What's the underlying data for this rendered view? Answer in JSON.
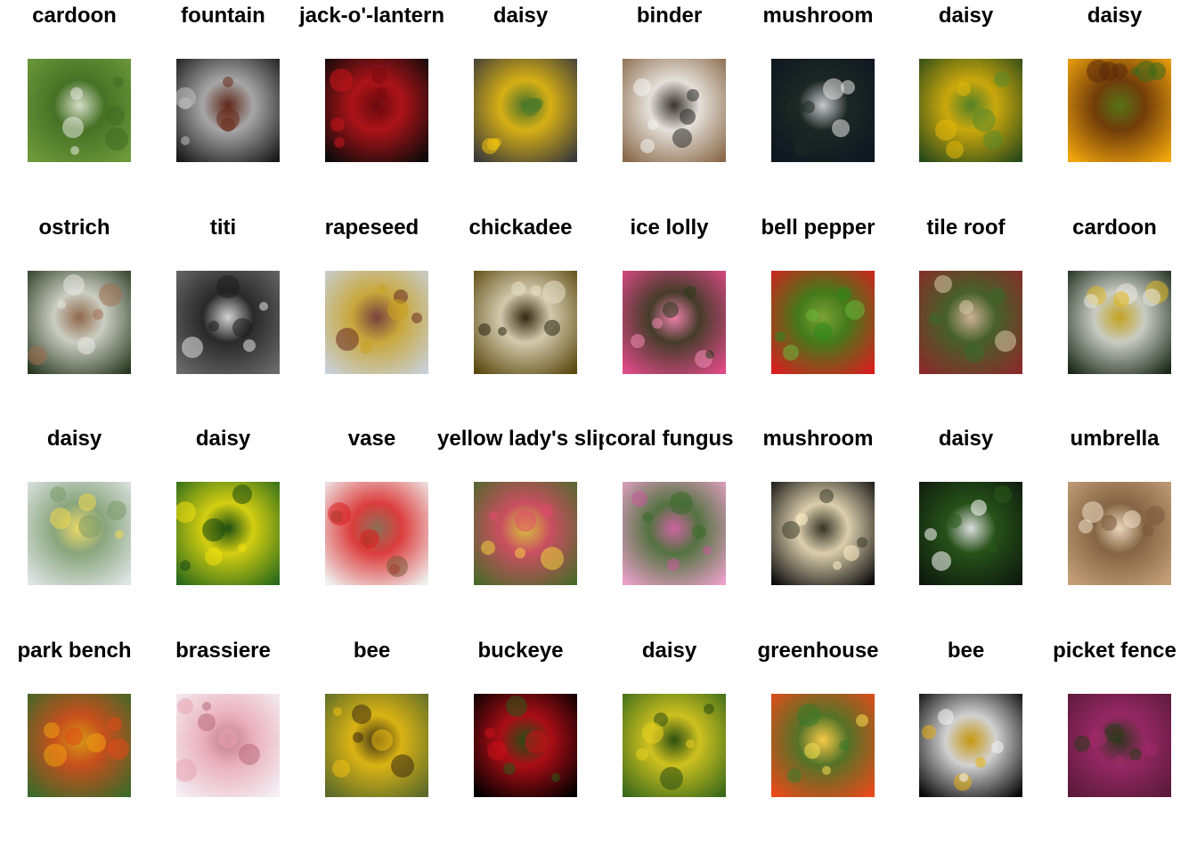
{
  "grid": {
    "columns": 8,
    "items": [
      {
        "label": "cardoon",
        "icon": "dandelion-seedhead-green-photo",
        "colors": [
          "#6f9a3c",
          "#3f6b22",
          "#e8e8e0"
        ]
      },
      {
        "label": "fountain",
        "icon": "dandelion-macro-bw-photo",
        "colors": [
          "#1a1a1a",
          "#bfbfbf",
          "#6a2a1a"
        ]
      },
      {
        "label": "jack-o'-lantern",
        "icon": "red-rose-photo",
        "colors": [
          "#0a0a0a",
          "#c8151b",
          "#7a0a0e"
        ]
      },
      {
        "label": "daisy",
        "icon": "sunflower-photo",
        "colors": [
          "#3a3a3a",
          "#f2c40f",
          "#4a7a2a"
        ]
      },
      {
        "label": "binder",
        "icon": "sticker-sheet-photo",
        "colors": [
          "#8a6a4a",
          "#f4f4f2",
          "#2a2a2a"
        ]
      },
      {
        "label": "mushroom",
        "icon": "dandelion-night-photo",
        "colors": [
          "#0e1620",
          "#1e2a24",
          "#e8e8e8"
        ]
      },
      {
        "label": "daisy",
        "icon": "sunflower-field-photo",
        "colors": [
          "#2a4a1a",
          "#e6b80a",
          "#5a8a2a"
        ]
      },
      {
        "label": "daisy",
        "icon": "sunflower-closeup-photo",
        "colors": [
          "#f3a70c",
          "#5a2a0a",
          "#3a6a1a"
        ]
      },
      {
        "label": "ostrich",
        "icon": "dandelion-blowing-photo",
        "colors": [
          "#2a3a22",
          "#e8e8e0",
          "#a07050"
        ]
      },
      {
        "label": "titi",
        "icon": "dandelion-gray-photo",
        "colors": [
          "#6a6a6a",
          "#1e1e1e",
          "#e4e4e4"
        ]
      },
      {
        "label": "rapeseed",
        "icon": "sunflower-farm-photo",
        "colors": [
          "#c8d0d8",
          "#c8a020",
          "#6a2a20"
        ]
      },
      {
        "label": "chickadee",
        "icon": "dandelion-olive-photo",
        "colors": [
          "#5a4a10",
          "#e8e0c8",
          "#2a2210"
        ]
      },
      {
        "label": "ice lolly",
        "icon": "pink-rose-photo",
        "colors": [
          "#e04a88",
          "#2a3a1a",
          "#f28ab4"
        ]
      },
      {
        "label": "bell pepper",
        "icon": "red-tulips-photo",
        "colors": [
          "#d81e1e",
          "#2a8a1a",
          "#6ab83a"
        ]
      },
      {
        "label": "tile roof",
        "icon": "red-house-garden-photo",
        "colors": [
          "#8a2a2a",
          "#3a6a2a",
          "#d8c8a8"
        ]
      },
      {
        "label": "cardoon",
        "icon": "dandelion-flower-photo",
        "colors": [
          "#1a2a1a",
          "#e8e8e0",
          "#e0b820"
        ]
      },
      {
        "label": "daisy",
        "icon": "white-daisies-photo",
        "colors": [
          "#dfe4e6",
          "#7a9a6a",
          "#f0d850"
        ]
      },
      {
        "label": "daisy",
        "icon": "yellow-dandelions-photo",
        "colors": [
          "#2a6a1a",
          "#f2e010",
          "#1a4a10"
        ]
      },
      {
        "label": "vase",
        "icon": "tulips-vase-photo",
        "colors": [
          "#f0f0f0",
          "#d81e1e",
          "#7a5a3a"
        ]
      },
      {
        "label": "yellow lady's slipper",
        "icon": "tulip-garden-photo",
        "colors": [
          "#4a6a2a",
          "#e04a6a",
          "#f0d040"
        ]
      },
      {
        "label": "coral fungus",
        "icon": "pink-bush-photo",
        "colors": [
          "#e8a0c8",
          "#3a6a2a",
          "#c85a9a"
        ]
      },
      {
        "label": "mushroom",
        "icon": "dandelion-backlit-photo",
        "colors": [
          "#0e0e0e",
          "#fff0c8",
          "#3a3a2a"
        ]
      },
      {
        "label": "daisy",
        "icon": "white-daisy-grass-photo",
        "colors": [
          "#0e1a0e",
          "#2a5a1a",
          "#ffffff"
        ]
      },
      {
        "label": "umbrella",
        "icon": "sepia-sunflowers-photo",
        "colors": [
          "#c4a07a",
          "#7a5a3a",
          "#f0e0c8"
        ]
      },
      {
        "label": "park bench",
        "icon": "tulip-park-photo",
        "colors": [
          "#3a6a2a",
          "#e04a1a",
          "#f0a010"
        ]
      },
      {
        "label": "brassiere",
        "icon": "pink-roses-photo",
        "colors": [
          "#f4f0f4",
          "#e8a4b4",
          "#b86a7a"
        ]
      },
      {
        "label": "bee",
        "icon": "sunflower-side-photo",
        "colors": [
          "#5a6a2a",
          "#f0c010",
          "#3a2a10"
        ]
      },
      {
        "label": "buckeye",
        "icon": "red-rose-dark-photo",
        "colors": [
          "#000000",
          "#c8101a",
          "#2a5a1a"
        ]
      },
      {
        "label": "daisy",
        "icon": "sunflower-meadow-photo",
        "colors": [
          "#3a6a1a",
          "#e8d020",
          "#2a4a10"
        ]
      },
      {
        "label": "greenhouse",
        "icon": "orange-flowers-photo",
        "colors": [
          "#e84a1a",
          "#3a7a2a",
          "#f8e050"
        ]
      },
      {
        "label": "bee",
        "icon": "bee-on-daisy-photo",
        "colors": [
          "#0a0a0a",
          "#f4f4f4",
          "#e8b010"
        ]
      },
      {
        "label": "picket fence",
        "icon": "purple-tulips-photo",
        "colors": [
          "#5a1a3a",
          "#a02a6a",
          "#2a3a1a"
        ]
      }
    ]
  }
}
